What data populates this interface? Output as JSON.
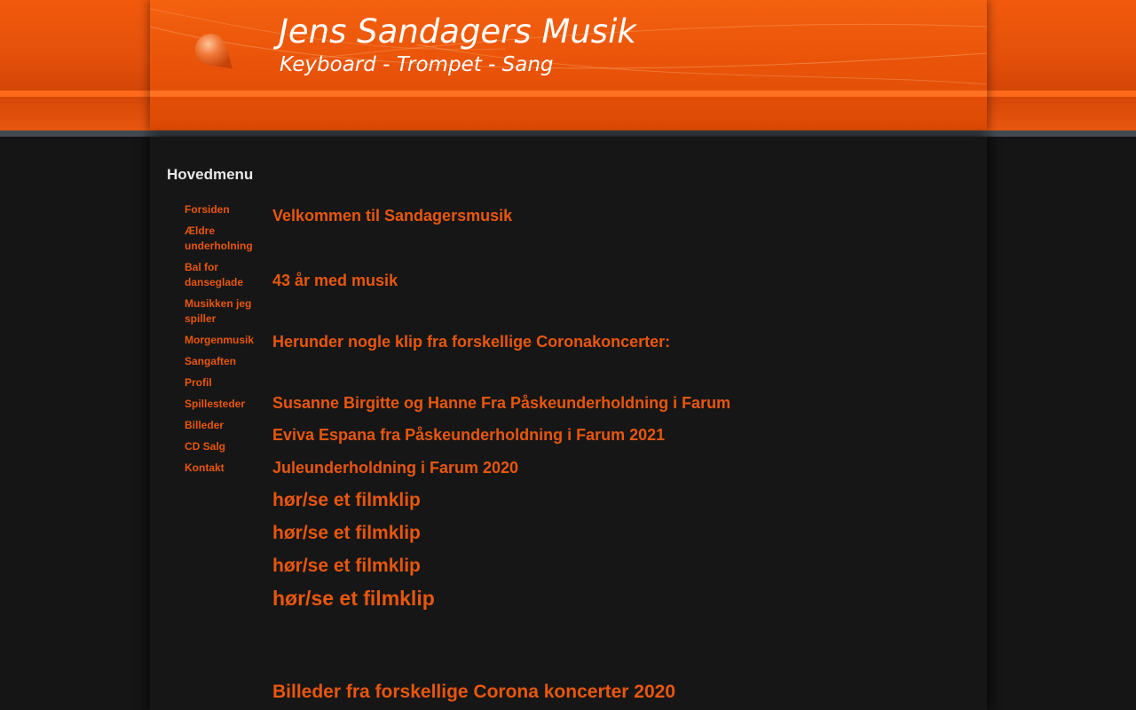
{
  "header": {
    "title": "Jens Sandagers Musik",
    "subtitle": "Keyboard - Trompet - Sang"
  },
  "colors": {
    "accent": "#e8560e",
    "header_orange": "#e85209",
    "background": "#151515",
    "heading_text": "#e8e8e8"
  },
  "sidebar": {
    "title": "Hovedmenu",
    "items": [
      {
        "label": "Forsiden"
      },
      {
        "label": "Ældre underholning"
      },
      {
        "label": "Bal for danseglade"
      },
      {
        "label": "Musikken jeg spiller"
      },
      {
        "label": "Morgenmusik"
      },
      {
        "label": "Sangaften"
      },
      {
        "label": "Profil"
      },
      {
        "label": "Spillesteder"
      },
      {
        "label": "Billeder"
      },
      {
        "label": "CD Salg"
      },
      {
        "label": "Kontakt"
      }
    ]
  },
  "main": {
    "welcome": "Velkommen til Sandagersmusik",
    "years": "43 år med musik",
    "intro": "Herunder nogle klip fra forskellige Coronakoncerter:",
    "clip_titles": [
      "Susanne Birgitte og Hanne Fra Påskeunderholdning i Farum",
      "Eviva Espana fra Påskeunderholdning i Farum 2021",
      "Juleunderholdning i Farum 2020"
    ],
    "film_links": [
      "hør/se et filmklip",
      "hør/se et filmklip",
      "hør/se et filmklip",
      "hør/se et filmklip"
    ],
    "photos_heading": "Billeder fra forskellige Corona koncerter 2020"
  }
}
